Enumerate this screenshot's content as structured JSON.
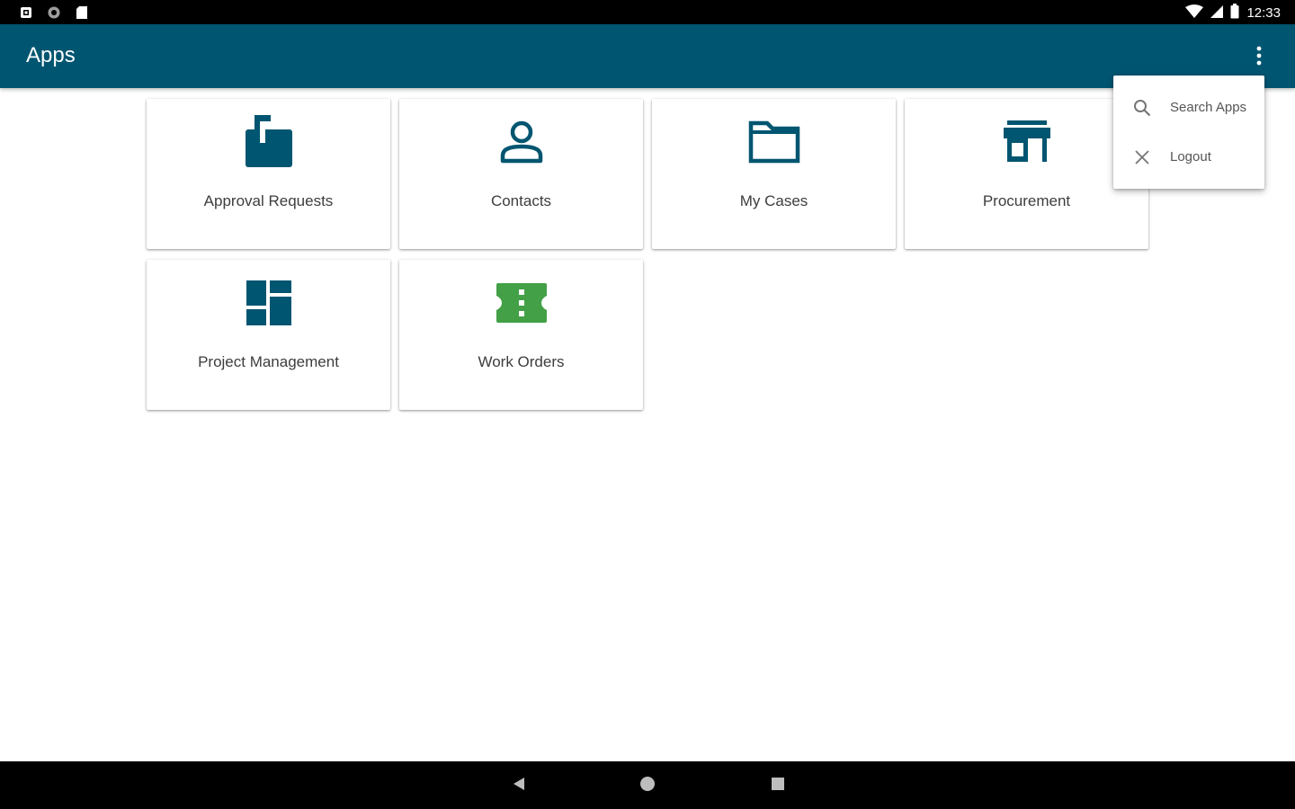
{
  "status_bar": {
    "time": "12:33",
    "left_icons": [
      "notification-icon",
      "sync-icon",
      "sd-card-icon"
    ],
    "right_icons": [
      "wifi-icon",
      "signal-icon",
      "battery-icon"
    ]
  },
  "app_bar": {
    "title": "Apps",
    "overflow_icon": "more-vert-icon"
  },
  "apps": [
    {
      "label": "Approval Requests",
      "icon": "mailbox-icon",
      "color": "#005570"
    },
    {
      "label": "Contacts",
      "icon": "person-icon",
      "color": "#005570"
    },
    {
      "label": "My Cases",
      "icon": "folder-icon",
      "color": "#005570"
    },
    {
      "label": "Procurement",
      "icon": "store-icon",
      "color": "#005570"
    },
    {
      "label": "Project Management",
      "icon": "dashboard-icon",
      "color": "#005570"
    },
    {
      "label": "Work Orders",
      "icon": "ticket-icon",
      "color": "#43a047"
    }
  ],
  "overflow_menu": {
    "items": [
      {
        "label": "Search Apps",
        "icon": "search-icon"
      },
      {
        "label": "Logout",
        "icon": "close-icon"
      }
    ]
  },
  "nav_bar": {
    "buttons": [
      "back-icon",
      "home-icon",
      "recents-icon"
    ]
  },
  "colors": {
    "primary": "#005570",
    "accent_green": "#43a047",
    "text": "#3d3d3d"
  }
}
